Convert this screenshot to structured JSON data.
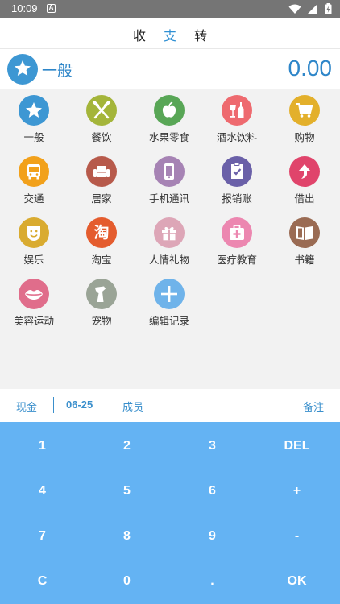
{
  "status": {
    "time": "10:09",
    "a_icon": "A"
  },
  "tabs": [
    {
      "label": "收",
      "active": false
    },
    {
      "label": "支",
      "active": true
    },
    {
      "label": "转",
      "active": false
    }
  ],
  "header": {
    "selected_category": "一般",
    "amount": "0.00"
  },
  "categories": [
    {
      "label": "一般",
      "icon": "star-icon",
      "color": "#3d97d3"
    },
    {
      "label": "餐饮",
      "icon": "utensils-icon",
      "color": "#a4b53a"
    },
    {
      "label": "水果零食",
      "icon": "apple-icon",
      "color": "#58a656"
    },
    {
      "label": "酒水饮料",
      "icon": "drinks-icon",
      "color": "#ee6a6f"
    },
    {
      "label": "购物",
      "icon": "cart-icon",
      "color": "#e3b02b"
    },
    {
      "label": "交通",
      "icon": "bus-icon",
      "color": "#f2a11b"
    },
    {
      "label": "居家",
      "icon": "sofa-icon",
      "color": "#b75a4b"
    },
    {
      "label": "手机通讯",
      "icon": "phone-icon",
      "color": "#a683b4"
    },
    {
      "label": "报销账",
      "icon": "document-check-icon",
      "color": "#6a60a8"
    },
    {
      "label": "借出",
      "icon": "arrow-up-icon",
      "color": "#e0446b"
    },
    {
      "label": "娱乐",
      "icon": "smile-icon",
      "color": "#d9ab30"
    },
    {
      "label": "淘宝",
      "icon": "taobao-icon",
      "color": "#e45c2e",
      "glyph": "淘"
    },
    {
      "label": "人情礼物",
      "icon": "gift-icon",
      "color": "#dda6b7"
    },
    {
      "label": "医疗教育",
      "icon": "medical-kit-icon",
      "color": "#ec87b0"
    },
    {
      "label": "书籍",
      "icon": "book-icon",
      "color": "#9a6b53"
    },
    {
      "label": "美容运动",
      "icon": "lips-icon",
      "color": "#e06d8b"
    },
    {
      "label": "宠物",
      "icon": "pet-icon",
      "color": "#9aa496"
    },
    {
      "label": "编辑记录",
      "icon": "plus-icon",
      "color": "#6fb3ea"
    }
  ],
  "info": {
    "account": "现金",
    "date": "06-25",
    "member": "成员",
    "note": "备注"
  },
  "keys": [
    [
      "1",
      "2",
      "3",
      "DEL"
    ],
    [
      "4",
      "5",
      "6",
      "+"
    ],
    [
      "7",
      "8",
      "9",
      "-"
    ],
    [
      "C",
      "0",
      ".",
      "OK"
    ]
  ]
}
